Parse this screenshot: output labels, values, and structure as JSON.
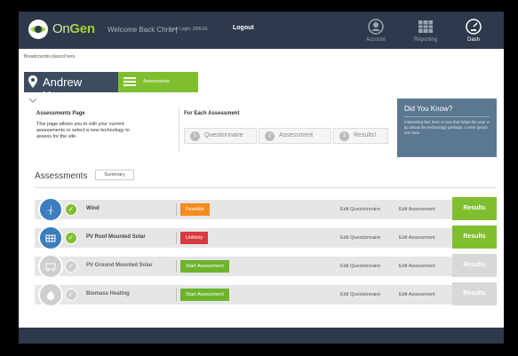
{
  "header": {
    "brand_on": "On",
    "brand_gen": "Gen",
    "welcome": "Welcome Back Chris |",
    "last_login": "Last Login: 20/6/16",
    "logout": "Logout",
    "nav": [
      {
        "label": "Account"
      },
      {
        "label": "Reporting"
      },
      {
        "label": "Dash"
      }
    ]
  },
  "breadcrumbs": "Breadcrumbs placed here.",
  "property": {
    "name": "Andrew House"
  },
  "section_tab": {
    "label": "Assessments"
  },
  "info": {
    "title": "Assessments Page",
    "text": "This page allows you to edit your current assessments or select a new technology to assess for the site."
  },
  "for_each": {
    "title": "For Each Assessment",
    "steps": [
      {
        "num": "1",
        "label": "Questionnaire"
      },
      {
        "num": "2",
        "label": "Assessment"
      },
      {
        "num": "3",
        "label": "Results!"
      }
    ]
  },
  "did_you_know": {
    "title": "Did You Know?",
    "body": "Interesting fact here or text that helps the user a tip about the technology perhaps. Lorem ipsum text here"
  },
  "assessments": {
    "heading": "Assessments",
    "summary_btn": "Summary",
    "rows": [
      {
        "name": "Wind",
        "status": "Feasible",
        "status_color": "#f28c1e",
        "edit_q": "Edit Questionnaire",
        "edit_a": "Edit Assessment",
        "results": "Results",
        "results_color": "#7fbf2f"
      },
      {
        "name": "PV Roof Mounted Solar",
        "status": "Unlikely",
        "status_color": "#d83a3f",
        "edit_q": "Edit Questionnaire",
        "edit_a": "Edit Assessment",
        "results": "Results",
        "results_color": "#7fbf2f"
      },
      {
        "name": "PV Ground Mounted Solar",
        "status": "Start Assessment",
        "status_color": "#6cb42c",
        "edit_q": "Edit Questionnaire",
        "edit_a": "Edit Assessment",
        "results": "Results",
        "results_color": "#d8d8d8"
      },
      {
        "name": "Biomass Heating",
        "status": "Start Assessment",
        "status_color": "#6cb42c",
        "edit_q": "Edit Questionnaire",
        "edit_a": "Edit Assessment",
        "results": "Results",
        "results_color": "#d8d8d8"
      }
    ]
  },
  "colors": {
    "topbar": "#2e3a4b",
    "accent_green": "#7fbf2f",
    "house_bg": "#3d4d60",
    "tip_bg": "#5b7890"
  }
}
